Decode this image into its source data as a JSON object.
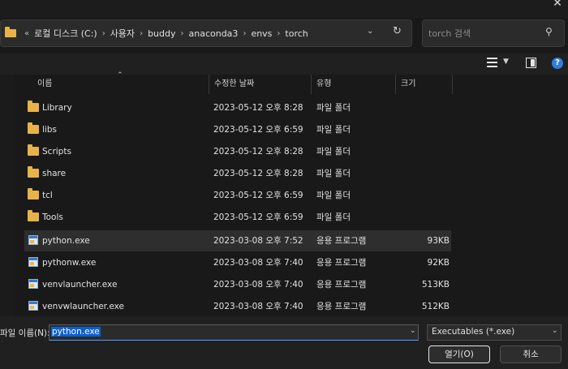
{
  "address": {
    "breadcrumbs": [
      "로컬 디스크 (C:)",
      "사용자",
      "buddy",
      "anaconda3",
      "envs",
      "torch"
    ],
    "overflow": "«"
  },
  "search": {
    "placeholder": "torch 검색"
  },
  "columns": {
    "name": "이름",
    "date": "수정한 날짜",
    "type": "유형",
    "size": "크기"
  },
  "files": [
    {
      "name": "Library",
      "date": "2023-05-12 오후 8:28",
      "type": "파일 폴더",
      "size": "",
      "kind": "folder"
    },
    {
      "name": "libs",
      "date": "2023-05-12 오후 6:59",
      "type": "파일 폴더",
      "size": "",
      "kind": "folder"
    },
    {
      "name": "Scripts",
      "date": "2023-05-12 오후 8:28",
      "type": "파일 폴더",
      "size": "",
      "kind": "folder"
    },
    {
      "name": "share",
      "date": "2023-05-12 오후 8:28",
      "type": "파일 폴더",
      "size": "",
      "kind": "folder"
    },
    {
      "name": "tcl",
      "date": "2023-05-12 오후 6:59",
      "type": "파일 폴더",
      "size": "",
      "kind": "folder"
    },
    {
      "name": "Tools",
      "date": "2023-05-12 오후 6:59",
      "type": "파일 폴더",
      "size": "",
      "kind": "folder"
    },
    {
      "name": "python.exe",
      "date": "2023-03-08 오후 7:52",
      "type": "응용 프로그램",
      "size": "93KB",
      "kind": "exe",
      "selected": true
    },
    {
      "name": "pythonw.exe",
      "date": "2023-03-08 오후 7:40",
      "type": "응용 프로그램",
      "size": "92KB",
      "kind": "exe"
    },
    {
      "name": "venvlauncher.exe",
      "date": "2023-03-08 오후 7:40",
      "type": "응용 프로그램",
      "size": "513KB",
      "kind": "exe"
    },
    {
      "name": "venvwlauncher.exe",
      "date": "2023-03-08 오후 7:40",
      "type": "응용 프로그램",
      "size": "512KB",
      "kind": "exe"
    }
  ],
  "bottom": {
    "filename_label": "파일 이름(N):",
    "filename_value": "python.exe",
    "filetype": "Executables (*.exe)",
    "open_label": "열기(O)",
    "cancel_label": "취소"
  },
  "icons": {
    "help": "?",
    "close": "✕"
  },
  "colors": {
    "accent": "#0a5fd1",
    "folder": "#e8b24a",
    "help": "#2d7fe0"
  }
}
